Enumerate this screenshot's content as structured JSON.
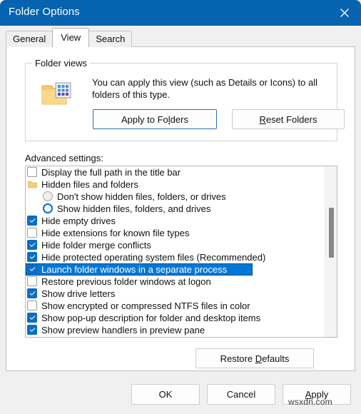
{
  "window": {
    "title": "Folder Options",
    "close_icon": "close-icon",
    "titlebar_color": "#0563af"
  },
  "tabs": [
    {
      "label": "General",
      "active": false
    },
    {
      "label": "View",
      "active": true
    },
    {
      "label": "Search",
      "active": false
    }
  ],
  "folder_views": {
    "group_title": "Folder views",
    "icon": "folder-with-grid-icon",
    "description": "You can apply this view (such as Details or Icons) to all folders of this type.",
    "apply_button": {
      "pre": "Apply to Fo",
      "accel": "l",
      "post": "ders"
    },
    "reset_button": {
      "pre": "",
      "accel": "R",
      "post": "eset Folders"
    }
  },
  "advanced": {
    "label": "Advanced settings:",
    "selection_color": "#0078d7",
    "items": [
      {
        "type": "checkbox",
        "checked": false,
        "indent": false,
        "label": "Display the full path in the title bar",
        "selected": false
      },
      {
        "type": "folder",
        "checked": false,
        "indent": false,
        "label": "Hidden files and folders",
        "selected": false
      },
      {
        "type": "radio",
        "checked": false,
        "indent": true,
        "label": "Don't show hidden files, folders, or drives",
        "selected": false
      },
      {
        "type": "radio",
        "checked": true,
        "indent": true,
        "label": "Show hidden files, folders, and drives",
        "selected": false
      },
      {
        "type": "checkbox",
        "checked": true,
        "indent": false,
        "label": "Hide empty drives",
        "selected": false
      },
      {
        "type": "checkbox",
        "checked": false,
        "indent": false,
        "label": "Hide extensions for known file types",
        "selected": false
      },
      {
        "type": "checkbox",
        "checked": true,
        "indent": false,
        "label": "Hide folder merge conflicts",
        "selected": false
      },
      {
        "type": "checkbox",
        "checked": true,
        "indent": false,
        "label": "Hide protected operating system files (Recommended)",
        "selected": false
      },
      {
        "type": "checkbox",
        "checked": true,
        "indent": false,
        "label": "Launch folder windows in a separate process",
        "selected": true
      },
      {
        "type": "checkbox",
        "checked": false,
        "indent": false,
        "label": "Restore previous folder windows at logon",
        "selected": false
      },
      {
        "type": "checkbox",
        "checked": true,
        "indent": false,
        "label": "Show drive letters",
        "selected": false
      },
      {
        "type": "checkbox",
        "checked": false,
        "indent": false,
        "label": "Show encrypted or compressed NTFS files in color",
        "selected": false
      },
      {
        "type": "checkbox",
        "checked": true,
        "indent": false,
        "label": "Show pop-up description for folder and desktop items",
        "selected": false
      },
      {
        "type": "checkbox",
        "checked": true,
        "indent": false,
        "label": "Show preview handlers in preview pane",
        "selected": false
      }
    ],
    "restore_defaults": {
      "pre": "Restore ",
      "accel": "D",
      "post": "efaults"
    }
  },
  "footer": {
    "ok": "OK",
    "cancel": "Cancel",
    "apply": {
      "pre": "",
      "accel": "A",
      "post": "pply"
    }
  },
  "watermark": "wsxdn.com"
}
